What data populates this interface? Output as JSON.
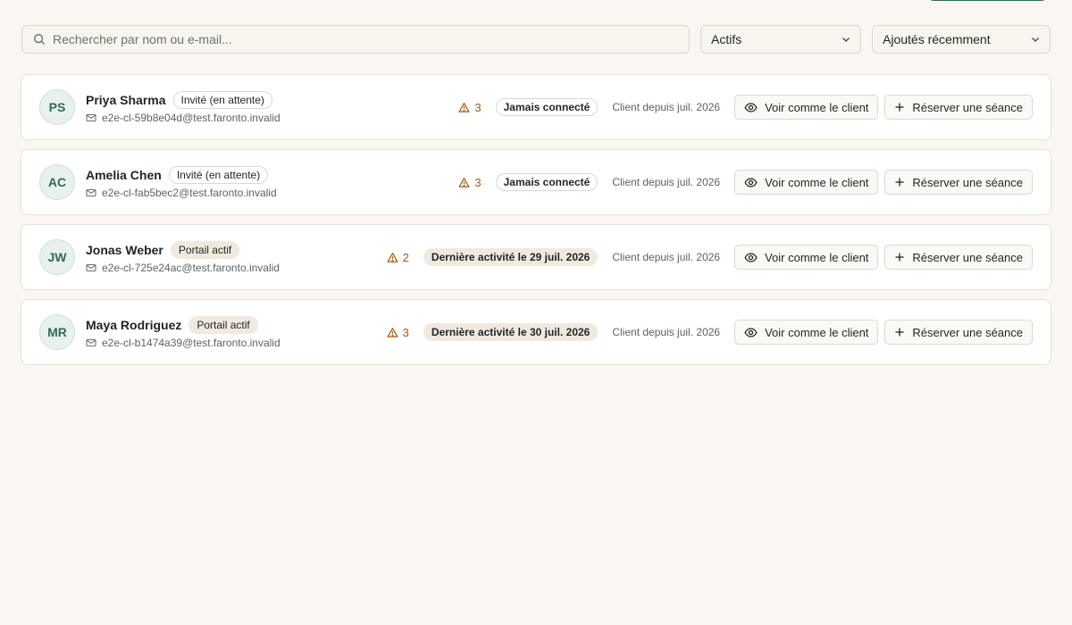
{
  "filters": {
    "search_placeholder": "Rechercher par nom ou e-mail...",
    "status_value": "Actifs",
    "sort_value": "Ajoutés récemment"
  },
  "actions": {
    "view_label": "Voir comme le client",
    "book_label": "Réserver une séance"
  },
  "clients": [
    {
      "initials": "PS",
      "name": "Priya Sharma",
      "status": "Invité (en attente)",
      "email": "e2e-cl-59b8e04d@test.faronto.invalid",
      "alerts": "3",
      "activity": "Jamais connecté",
      "since": "Client depuis juil. 2026"
    },
    {
      "initials": "AC",
      "name": "Amelia Chen",
      "status": "Invité (en attente)",
      "email": "e2e-cl-fab5bec2@test.faronto.invalid",
      "alerts": "3",
      "activity": "Jamais connecté",
      "since": "Client depuis juil. 2026"
    },
    {
      "initials": "JW",
      "name": "Jonas Weber",
      "status": "Portail actif",
      "email": "e2e-cl-725e24ac@test.faronto.invalid",
      "alerts": "2",
      "activity": "Dernière activité le 29 juil. 2026",
      "since": "Client depuis juil. 2026"
    },
    {
      "initials": "MR",
      "name": "Maya Rodriguez",
      "status": "Portail actif",
      "email": "e2e-cl-b1474a39@test.faronto.invalid",
      "alerts": "3",
      "activity": "Dernière activité le 30 juil. 2026",
      "since": "Client depuis juil. 2026"
    }
  ]
}
